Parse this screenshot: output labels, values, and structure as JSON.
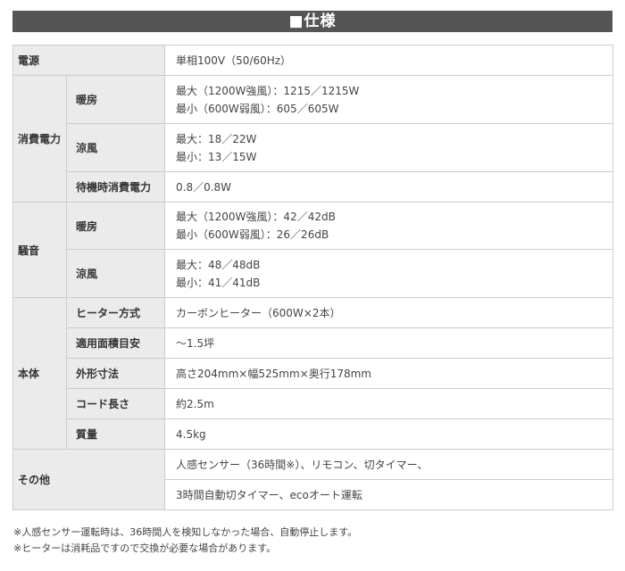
{
  "title": "■仕様",
  "rows": {
    "power_source": {
      "label": "電源",
      "value": "単相100V（50/60Hz）"
    },
    "power_consumption": {
      "label": "消費電力",
      "heating": {
        "label": "暖房",
        "line1": "最大（1200W強風）：1215／1215W",
        "line2": "最小（600W弱風）：605／605W"
      },
      "cooling": {
        "label": "涼風",
        "line1": "最大：18／22W",
        "line2": "最小：13／15W"
      },
      "standby": {
        "label": "待機時消費電力",
        "value": "0.8／0.8W"
      }
    },
    "noise": {
      "label": "騒音",
      "heating": {
        "label": "暖房",
        "line1": "最大（1200W強風）：42／42dB",
        "line2": "最小（600W弱風）：26／26dB"
      },
      "cooling": {
        "label": "涼風",
        "line1": "最大：48／48dB",
        "line2": "最小：41／41dB"
      }
    },
    "body": {
      "label": "本体",
      "heater_type": {
        "label": "ヒーター方式",
        "value": "カーボンヒーター（600W×2本）"
      },
      "area": {
        "label": "適用面積目安",
        "value": "〜1.5坪"
      },
      "dimensions": {
        "label": "外形寸法",
        "value": "高さ204mm×幅525mm×奥行178mm"
      },
      "cord_length": {
        "label": "コード長さ",
        "value": "約2.5m"
      },
      "weight": {
        "label": "質量",
        "value": "4.5kg"
      }
    },
    "other": {
      "label": "その他",
      "line1": "人感センサー（36時間※）、リモコン、切タイマー、",
      "line2": "3時間自動切タイマー、ecoオート運転"
    }
  },
  "notes": [
    "※人感センサー運転時は、36時間人を検知しなかった場合、自動停止します。",
    "※ヒーターは消耗品ですので交換が必要な場合があります。"
  ]
}
